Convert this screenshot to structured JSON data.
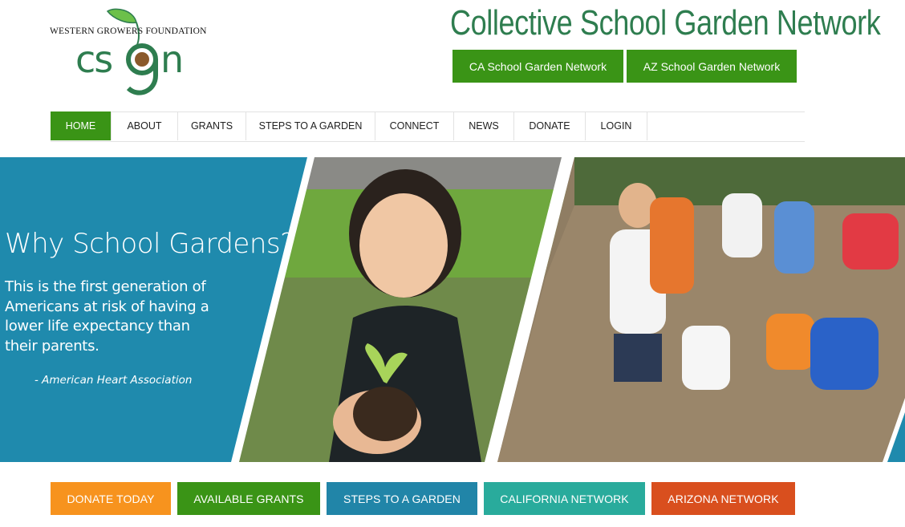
{
  "logo": {
    "org_line": "WESTERN GROWERS FOUNDATION",
    "mark_text": "csgn",
    "colors": {
      "green": "#2e7d4f",
      "leaf": "#6cc04a",
      "seed": "#8a5a2b"
    }
  },
  "header": {
    "site_title": "Collective School Garden Network",
    "network_buttons": [
      {
        "label": "CA School Garden Network"
      },
      {
        "label": "AZ School Garden Network"
      }
    ]
  },
  "nav": {
    "items": [
      {
        "label": "HOME",
        "active": true
      },
      {
        "label": "ABOUT"
      },
      {
        "label": "GRANTS"
      },
      {
        "label": "STEPS TO A GARDEN"
      },
      {
        "label": "CONNECT"
      },
      {
        "label": "NEWS"
      },
      {
        "label": "DONATE"
      },
      {
        "label": "LOGIN"
      }
    ]
  },
  "hero": {
    "title": "Why School Gardens?",
    "quote": "This is the first generation of Americans at risk of having a lower life expectancy than their parents.",
    "citation": "- American Heart Association",
    "panel_color": "#1f8aad"
  },
  "cta_buttons": [
    {
      "label": "DONATE TODAY",
      "color": "#f7931e"
    },
    {
      "label": "AVAILABLE GRANTS",
      "color": "#3a9416"
    },
    {
      "label": "STEPS TO A GARDEN",
      "color": "#2185a8"
    },
    {
      "label": "CALIFORNIA NETWORK",
      "color": "#29ab9c"
    },
    {
      "label": "ARIZONA NETWORK",
      "color": "#d94f1e"
    }
  ],
  "colors": {
    "accent_green": "#3a9416",
    "title_green": "#2e7d4f"
  }
}
